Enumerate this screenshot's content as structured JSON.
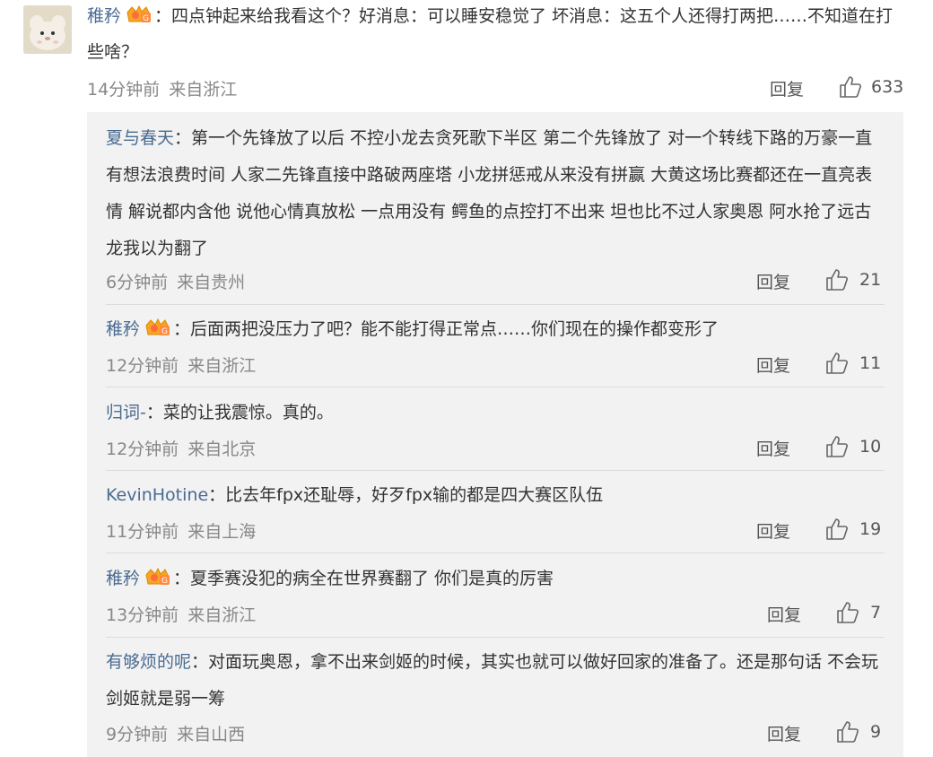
{
  "main_comment": {
    "username": "稚矜",
    "text": "：四点钟起来给我看这个？好消息：可以睡安稳觉了 坏消息：这五个人还得打两把……不知道在打些啥？",
    "time": "14分钟前",
    "location": "来自浙江",
    "reply_label": "回复",
    "likes": "633"
  },
  "replies": [
    {
      "username": "夏与春天",
      "text": "：第一个先锋放了以后 不控小龙去贪死歌下半区 第二个先锋放了 对一个转线下路的万豪一直有想法浪费时间 人家二先锋直接中路破两座塔 小龙拼惩戒从来没有拼赢 大黄这场比赛都还在一直亮表情 解说都内含他 说他心情真放松 一点用没有 鳄鱼的点控打不出来 坦也比不过人家奥恩 阿水抢了远古龙我以为翻了",
      "time": "6分钟前",
      "location": "来自贵州",
      "reply_label": "回复",
      "likes": "21",
      "badge": false
    },
    {
      "username": "稚矜",
      "text": "：后面两把没压力了吧？能不能打得正常点……你们现在的操作都变形了",
      "time": "12分钟前",
      "location": "来自浙江",
      "reply_label": "回复",
      "likes": "11",
      "badge": true
    },
    {
      "username": "归词-",
      "text": "：菜的让我震惊。真的。",
      "time": "12分钟前",
      "location": "来自北京",
      "reply_label": "回复",
      "likes": "10",
      "badge": false
    },
    {
      "username": "KevinHotine",
      "text": "：比去年fpx还耻辱，好歹fpx输的都是四大赛区队伍",
      "time": "11分钟前",
      "location": "来自上海",
      "reply_label": "回复",
      "likes": "19",
      "badge": false
    },
    {
      "username": "稚矜",
      "text": "：夏季赛没犯的病全在世界赛翻了 你们是真的厉害",
      "time": "13分钟前",
      "location": "来自浙江",
      "reply_label": "回复",
      "likes": "7",
      "badge": true
    },
    {
      "username": "有够烦的呢",
      "text": "：对面玩奥恩，拿不出来剑姬的时候，其实也就可以做好回家的准备了。还是那句话 不会玩剑姬就是弱一筹",
      "time": "9分钟前",
      "location": "来自山西",
      "reply_label": "回复",
      "likes": "9",
      "badge": false
    }
  ],
  "colors": {
    "username": "#4a6b91",
    "reply_bg": "#f2f2f2",
    "meta": "#888888"
  },
  "icons": {
    "like": "thumbs-up-icon",
    "badge": "vip-crown-badge-icon"
  }
}
